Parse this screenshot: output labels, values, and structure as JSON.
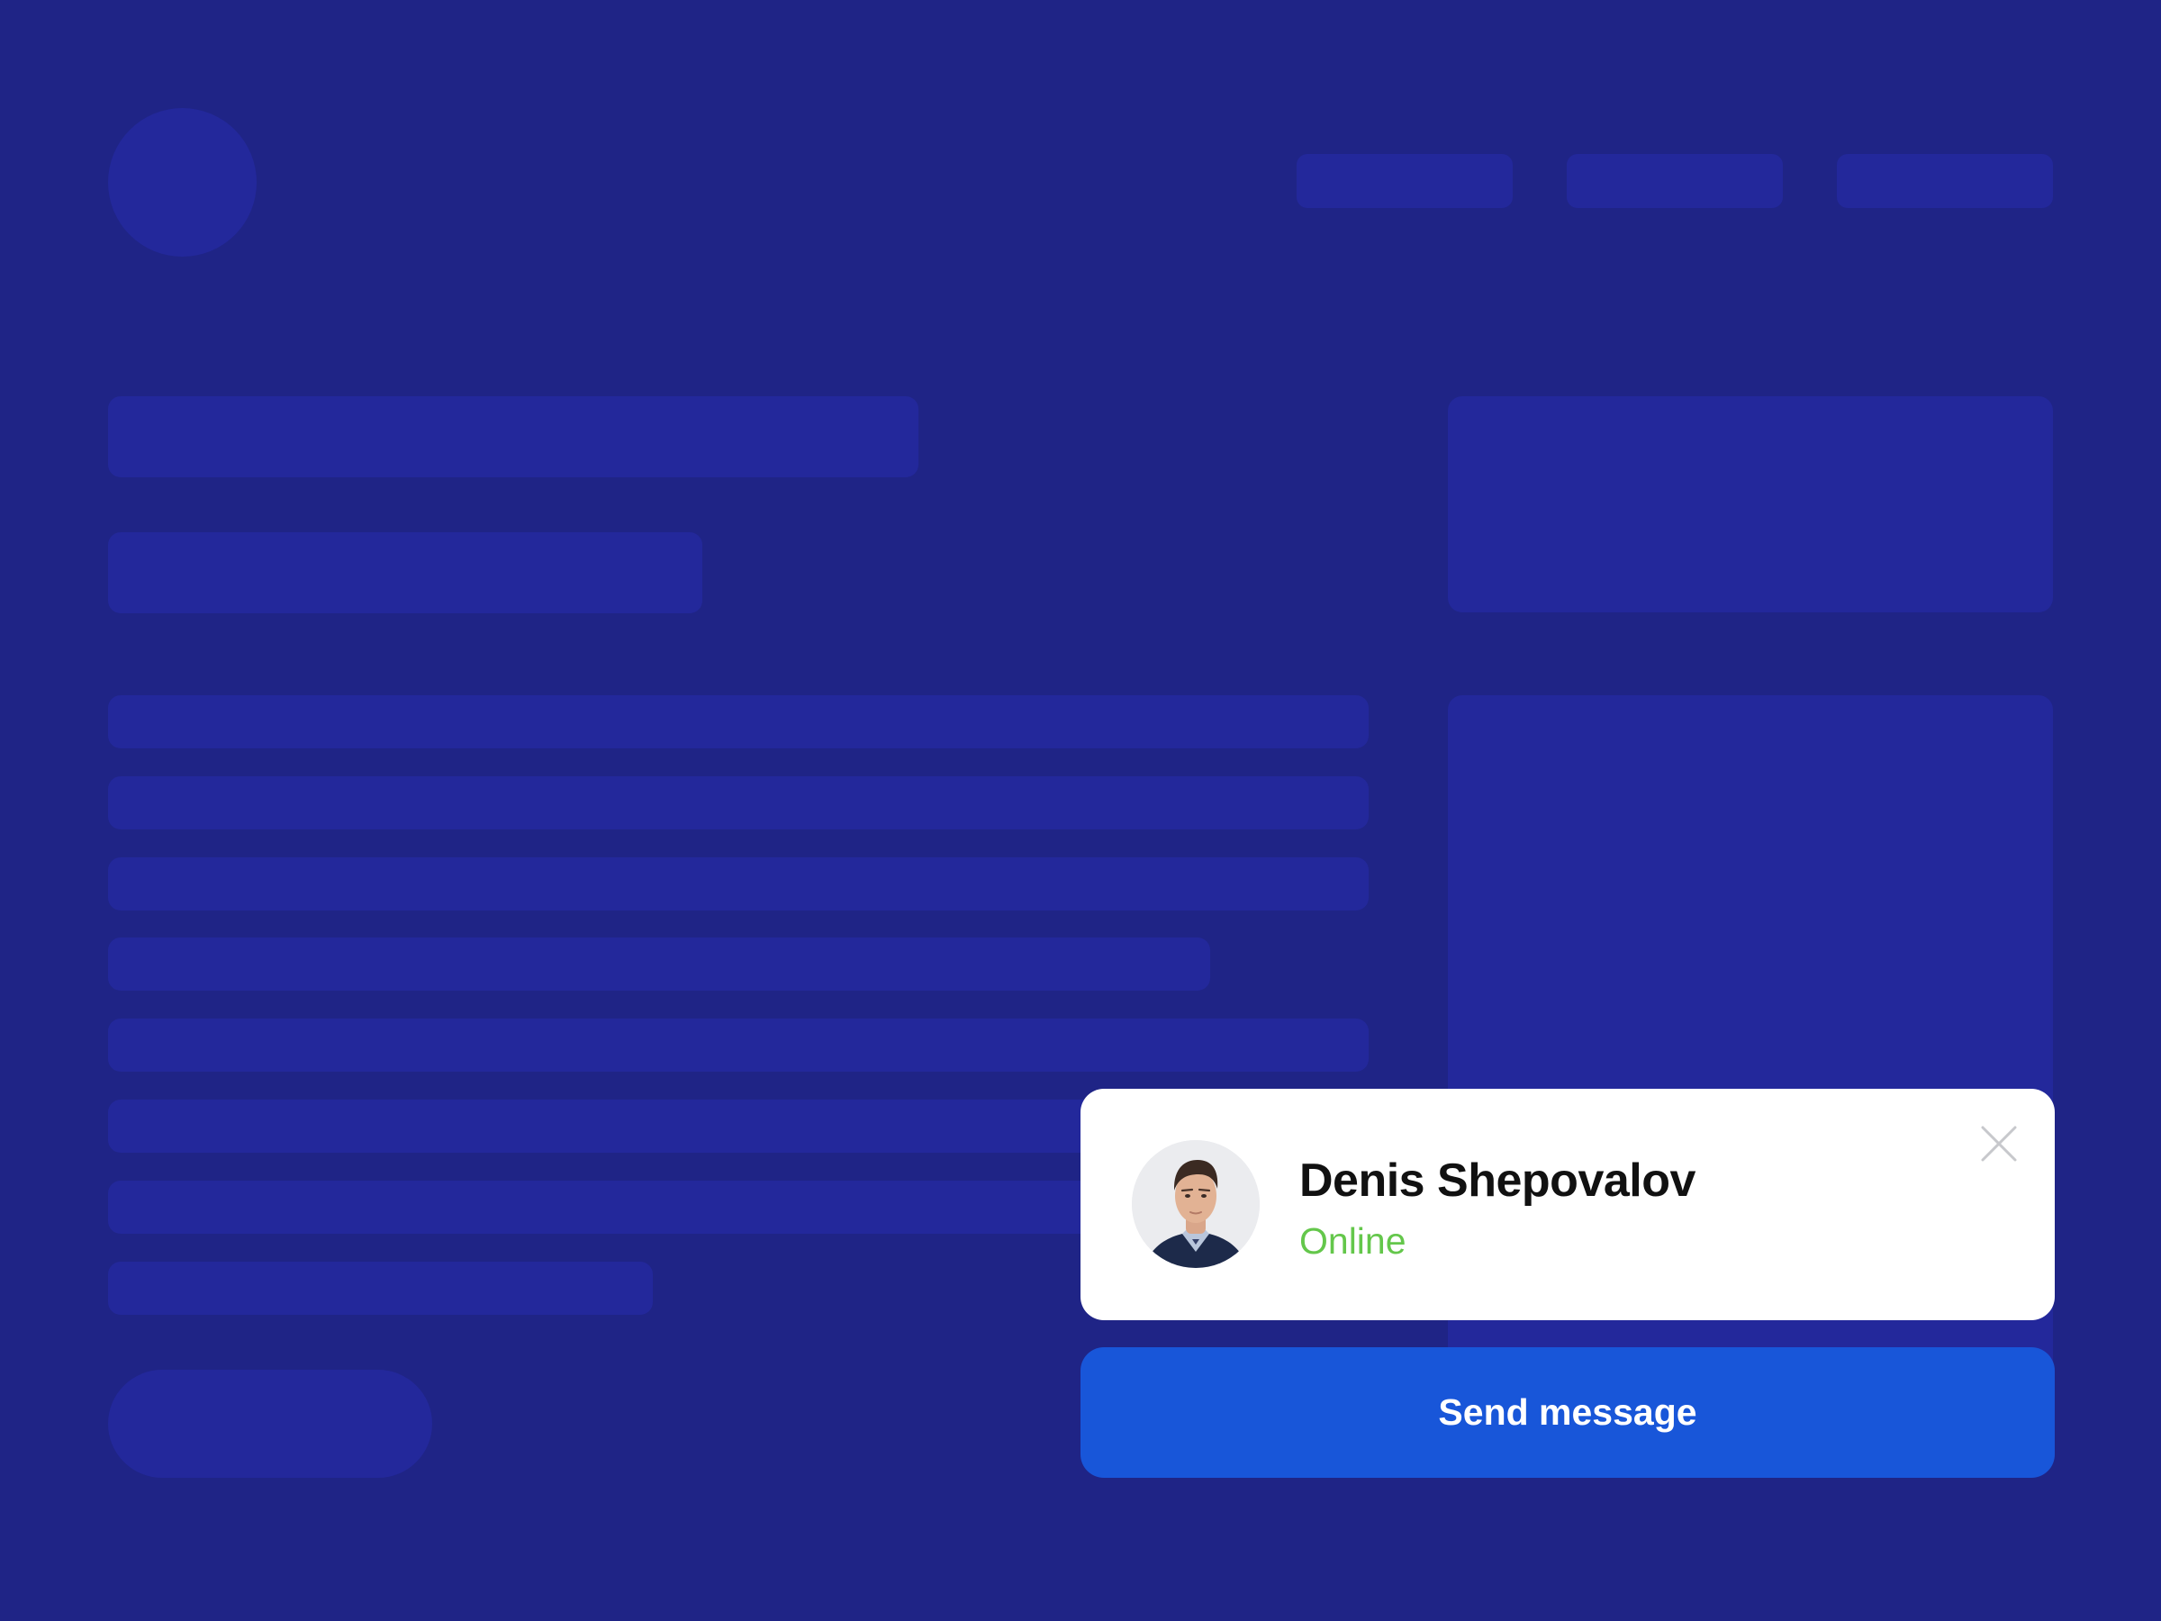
{
  "colors": {
    "background": "#1f2486",
    "placeholder": "#23289b",
    "card": "#ffffff",
    "status_online": "#64c74b",
    "button": "#1856d9",
    "button_text": "#ffffff"
  },
  "contact": {
    "name": "Denis Shepovalov",
    "status": "Online",
    "avatar_icon": "avatar-photo",
    "close_icon": "close-icon"
  },
  "actions": {
    "send_label": "Send message"
  }
}
